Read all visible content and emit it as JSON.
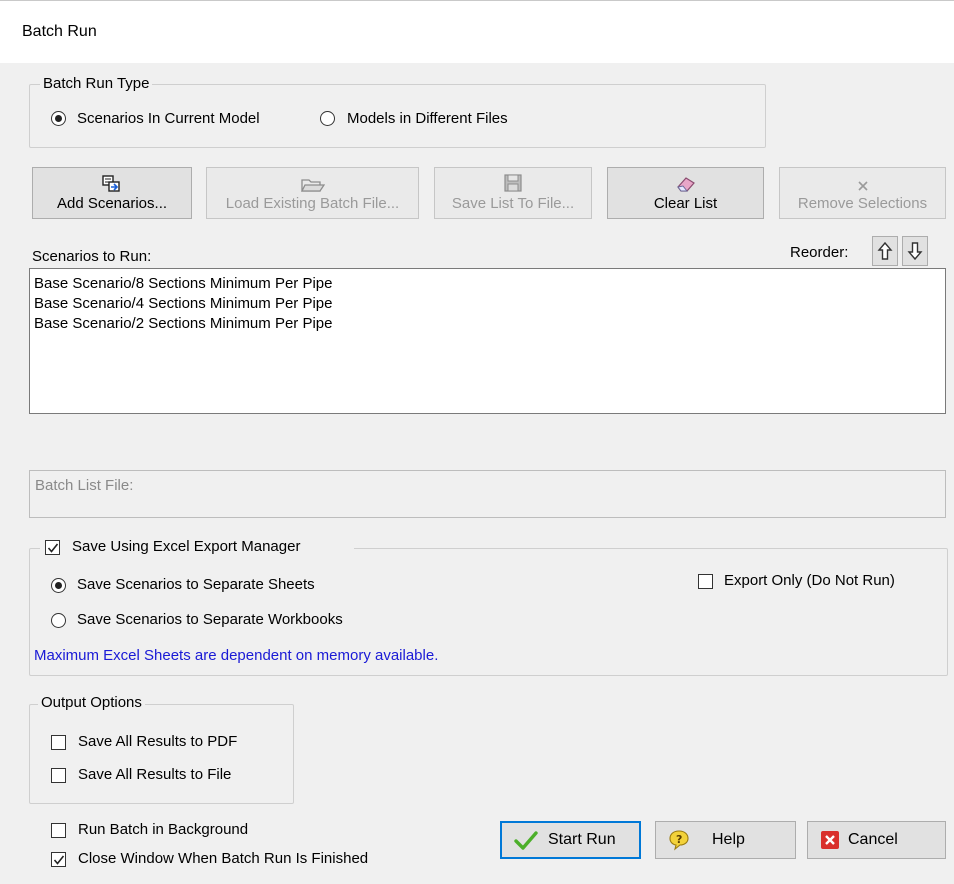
{
  "window": {
    "title": "Batch Run"
  },
  "batch_run_type": {
    "legend": "Batch Run Type",
    "options": [
      {
        "label": "Scenarios In Current Model",
        "selected": true
      },
      {
        "label": "Models in Different Files",
        "selected": false
      }
    ]
  },
  "toolbar": {
    "add_scenarios": "Add Scenarios...",
    "load_existing": "Load Existing Batch File...",
    "save_list": "Save List To File...",
    "clear_list": "Clear List",
    "remove_selections": "Remove Selections"
  },
  "scenarios": {
    "label": "Scenarios to Run:",
    "reorder_label": "Reorder:",
    "items": [
      "Base Scenario/8 Sections Minimum Per Pipe",
      "Base Scenario/4 Sections Minimum Per Pipe",
      "Base Scenario/2 Sections Minimum Per Pipe"
    ]
  },
  "batch_list_file": {
    "placeholder": "Batch List File:"
  },
  "excel": {
    "legend": "Save Using Excel Export Manager",
    "checked": true,
    "options": [
      {
        "label": "Save Scenarios to Separate Sheets",
        "selected": true
      },
      {
        "label": "Save Scenarios to Separate Workbooks",
        "selected": false
      }
    ],
    "export_only": "Export Only (Do Not Run)",
    "note": "Maximum Excel Sheets are dependent on memory available."
  },
  "output_options": {
    "legend": "Output Options",
    "pdf": "Save All Results to PDF",
    "file": "Save All Results to File"
  },
  "run_background": "Run Batch in Background",
  "close_window": "Close Window When Batch Run Is Finished",
  "buttons": {
    "start": "Start Run",
    "help": "Help",
    "cancel": "Cancel"
  },
  "colors": {
    "info_text": "#1a1ad6",
    "primary_border": "#0078d7",
    "cancel_red": "#d9302c",
    "check_green": "#4caf2a"
  }
}
